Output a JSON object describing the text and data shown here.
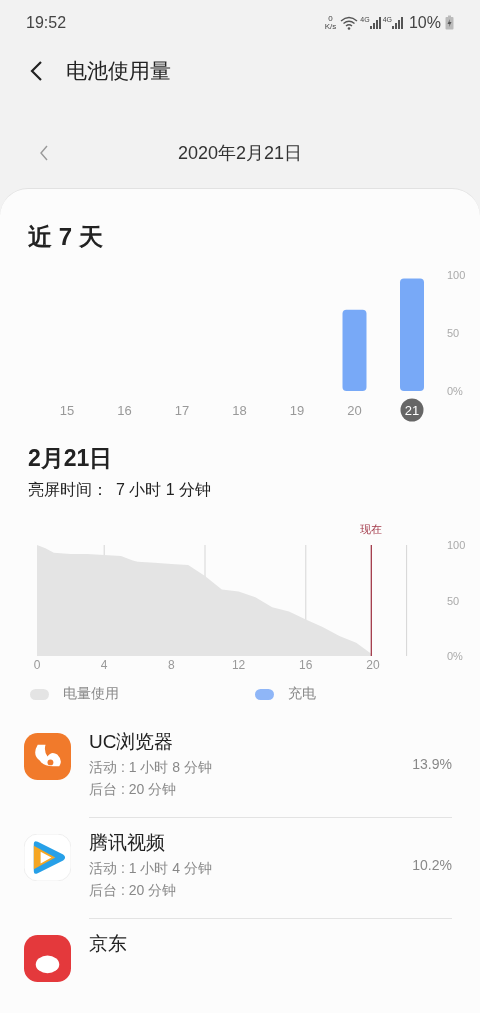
{
  "status_bar": {
    "time": "19:52",
    "net_speed_value": "0",
    "net_speed_unit": "K/s",
    "signals": [
      {
        "label": "4G"
      },
      {
        "label": "4G"
      }
    ],
    "battery": "10%"
  },
  "header": {
    "title": "电池使用量"
  },
  "date_nav": {
    "date": "2020年2月21日"
  },
  "week": {
    "title": "近 7 天",
    "chart_data": {
      "type": "bar",
      "categories": [
        "15",
        "16",
        "17",
        "18",
        "19",
        "20",
        "21"
      ],
      "values": [
        null,
        null,
        null,
        null,
        null,
        70,
        97
      ],
      "ylim": [
        0,
        100
      ],
      "yticks": [
        {
          "value": 0,
          "label": "0%"
        },
        {
          "value": 50,
          "label": "50"
        },
        {
          "value": 100,
          "label": "100"
        }
      ]
    },
    "days": [
      {
        "selected": false
      },
      {
        "selected": false
      },
      {
        "selected": false
      },
      {
        "selected": false
      },
      {
        "selected": false
      },
      {
        "selected": false
      },
      {
        "selected": true
      }
    ]
  },
  "day": {
    "title": "2月21日",
    "screen_time_label": "亮屏时间：",
    "screen_time_value": "7 小时 1 分钟",
    "chart_data": {
      "type": "area",
      "x": [
        0,
        0.5,
        1,
        2,
        3,
        4,
        5,
        5.7,
        6,
        7,
        8,
        9,
        10,
        11,
        12,
        13,
        14,
        15,
        16,
        17,
        18,
        19,
        19.9
      ],
      "series": [
        {
          "name": "电量使用",
          "color": "#e4e4e4",
          "values": [
            100,
            97,
            93,
            92,
            92,
            91,
            90,
            86,
            85,
            84,
            83,
            82,
            72,
            60,
            58,
            53,
            44,
            40,
            33,
            26,
            18,
            12,
            2
          ]
        }
      ],
      "xlim": [
        0,
        22
      ],
      "ylim": [
        0,
        100
      ],
      "xticks": [
        0,
        4,
        8,
        12,
        16,
        20
      ],
      "yticks": [
        {
          "value": 0,
          "label": "0%"
        },
        {
          "value": 50,
          "label": "50"
        },
        {
          "value": 100,
          "label": "100"
        }
      ],
      "ref_lines": [
        {
          "axis": "x",
          "value": 19.9,
          "label": "现在",
          "color": "#a33a4a"
        }
      ]
    },
    "legend": [
      {
        "label": "充电",
        "color": "#8fb6f7"
      }
    ]
  },
  "apps": [
    {
      "kind": "squirrel",
      "name": "UC浏览器",
      "active": "活动 : 1 小时 8 分钟",
      "background": "后台 : 20 分钟",
      "percent": "13.9%"
    },
    {
      "kind": "play",
      "name": "腾讯视频",
      "active": "活动 : 1 小时 4 分钟",
      "background": "后台 : 20 分钟",
      "percent": "10.2%"
    },
    {
      "kind": "dog",
      "name": "京东"
    }
  ]
}
